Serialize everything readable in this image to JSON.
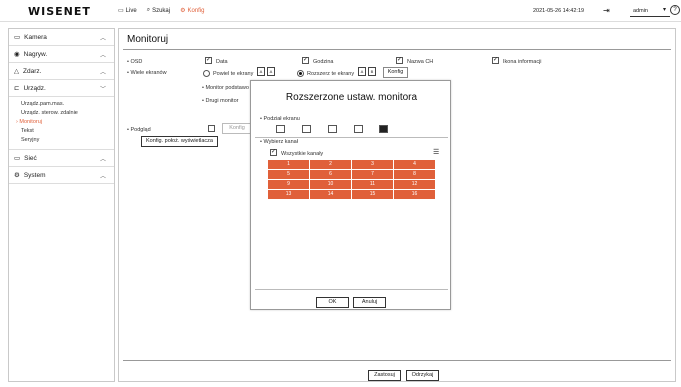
{
  "header": {
    "logo": "WISENET",
    "nav": [
      {
        "label": "Live",
        "icon": "monitor-icon"
      },
      {
        "label": "Szukaj",
        "icon": "search-icon"
      },
      {
        "label": "Konfig",
        "icon": "gear-icon"
      }
    ],
    "datetime": "2021-05-26 14:42:19",
    "user": "admin"
  },
  "sidebar": {
    "items": [
      {
        "label": "Kamera",
        "icon": "camera-icon",
        "expanded": false
      },
      {
        "label": "Nagryw.",
        "icon": "record-icon",
        "expanded": false
      },
      {
        "label": "Zdarz.",
        "icon": "bell-icon",
        "expanded": false
      },
      {
        "label": "Urządz.",
        "icon": "device-icon",
        "expanded": true
      },
      {
        "label": "Sieć",
        "icon": "network-icon",
        "expanded": false
      },
      {
        "label": "System",
        "icon": "gear-icon",
        "expanded": false
      }
    ],
    "sub": [
      "Urządz.pam.mas.",
      "Urządz. sterow. zdalnie",
      "Monitoruj",
      "Tekst",
      "Seryjny"
    ],
    "selected_sub": "Monitoruj"
  },
  "main": {
    "title": "Monitoruj",
    "osd_label": "OSD",
    "osd_options": [
      "Data",
      "Godzina",
      "Nazwa CH",
      "Ikona informacji"
    ],
    "multi_label": "Wiele ekranów",
    "radio_dup": "Powiel te ekrany",
    "radio_ext": "Rozszerz te ekrany",
    "konfig_btn": "Konfig",
    "main_monitor": "Monitor podstawo",
    "second_monitor": "Drugi monitor",
    "podglad": "Podgląd",
    "podglad_konfig": "Konfig",
    "config_pos_btn": "Konfig. położ. wyświetlacza",
    "apply": "Zastosuj",
    "cancel": "Odrzykaj"
  },
  "modal": {
    "title": "Rozszerzone ustaw. monitora",
    "split_label": "Podział ekranu",
    "select_label": "Wybierz kanał",
    "all_label": "Wszystkie kanały",
    "channels": [
      "1",
      "2",
      "3",
      "4",
      "5",
      "6",
      "7",
      "8",
      "9",
      "10",
      "11",
      "12",
      "13",
      "14",
      "15",
      "16"
    ],
    "ok": "OK",
    "cancel": "Anuluj"
  },
  "colors": {
    "accent": "#e0603a"
  }
}
